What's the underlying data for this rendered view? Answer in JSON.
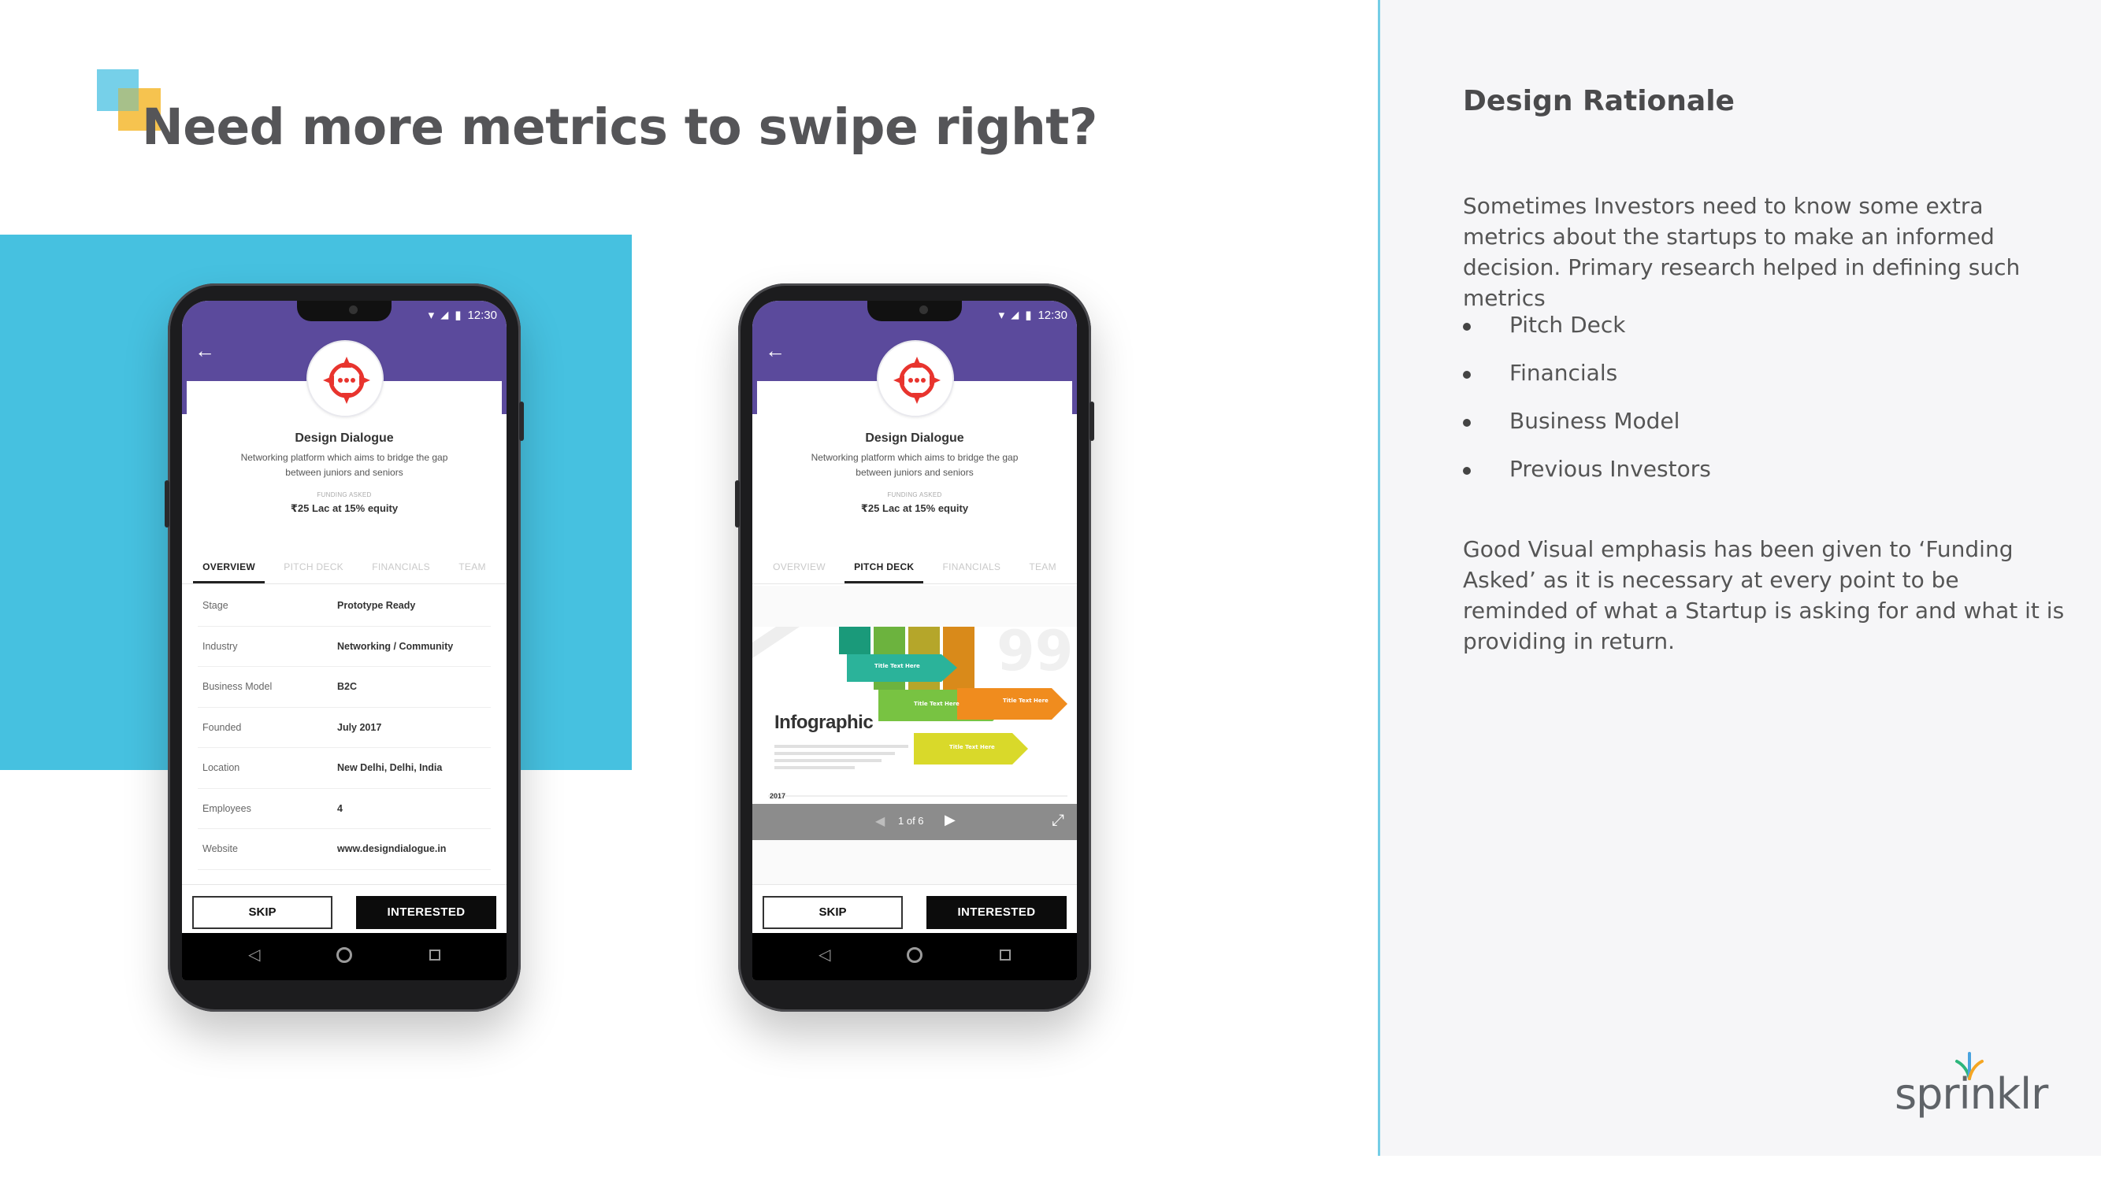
{
  "slide": {
    "title": "Need more metrics to swipe right?"
  },
  "phone_status": {
    "time": "12:30"
  },
  "startup": {
    "name": "Design Dialogue",
    "description": "Networking platform which aims to bridge the gap between juniors and seniors",
    "funding_label": "FUNDING ASKED",
    "funding_value": "₹25 Lac at 15% equity"
  },
  "tabs": [
    "OVERVIEW",
    "PITCH DECK",
    "FINANCIALS",
    "TEAM"
  ],
  "overview_rows": [
    {
      "key": "Stage",
      "value": "Prototype Ready"
    },
    {
      "key": "Industry",
      "value": "Networking / Community"
    },
    {
      "key": "Business Model",
      "value": "B2C"
    },
    {
      "key": "Founded",
      "value": "July 2017"
    },
    {
      "key": "Location",
      "value": "New Delhi, Delhi, India"
    },
    {
      "key": "Employees",
      "value": "4"
    },
    {
      "key": "Website",
      "value": "www.designdialogue.in"
    }
  ],
  "pitch_deck": {
    "slide_title": "Infographic",
    "slide_year": "2017",
    "arrow_labels": [
      "Title Text Here",
      "Title Text Here",
      "Title Text Here",
      "Title Text Here"
    ],
    "page_indicator": "1 of 6"
  },
  "actions": {
    "skip": "SKIP",
    "interested": "INTERESTED"
  },
  "rationale": {
    "title": "Design Rationale",
    "intro": "Sometimes Investors need to know some extra metrics about the startups to make an informed decision. Primary research helped in defining such metrics",
    "metrics": [
      "Pitch Deck",
      "Financials",
      "Business Model",
      "Previous Investors"
    ],
    "conclusion": "Good Visual emphasis has been given to ‘Funding Asked’ as it is necessary at every point to be reminded of what a Startup is asking for and what it is providing in return."
  },
  "brand": {
    "name": "sprinklr"
  },
  "colors": {
    "accent_blue": "#46c1e0",
    "header_purple": "#5b4a9c",
    "deco_yellow": "#f5bd3c",
    "logo_red": "#e8342e"
  }
}
